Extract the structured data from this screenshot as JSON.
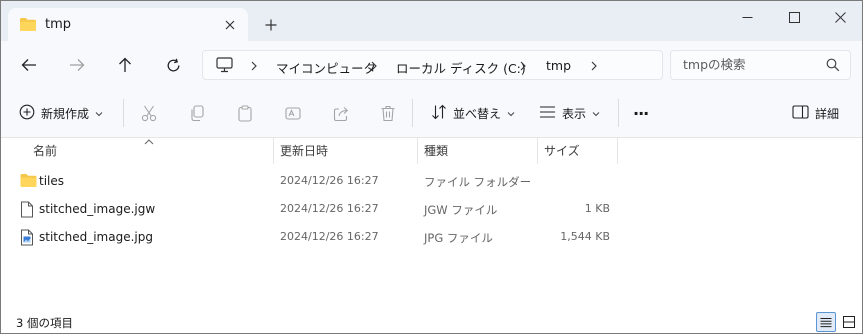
{
  "tab": {
    "title": "tmp",
    "folder_icon": "folder-icon",
    "close_icon": "close-icon"
  },
  "window": {
    "new_tab_icon": "plus-icon",
    "minimize_icon": "minimize-icon",
    "maximize_icon": "maximize-icon",
    "close_icon": "close-icon"
  },
  "nav": {
    "back_icon": "arrow-left-icon",
    "forward_icon": "arrow-right-icon",
    "up_icon": "arrow-up-icon",
    "refresh_icon": "refresh-icon",
    "breadcrumbs": [
      "マイコンピュータ",
      "ローカル ディスク (C:)",
      "tmp"
    ],
    "search_placeholder": "tmpの検索"
  },
  "toolbar": {
    "new_label": "新規作成",
    "sort_label": "並べ替え",
    "view_label": "表示",
    "more_label": "···",
    "details_label": "詳細"
  },
  "columns": {
    "name": "名前",
    "modified": "更新日時",
    "type": "種類",
    "size": "サイズ"
  },
  "files": [
    {
      "name": "tiles",
      "modified": "2024/12/26 16:27",
      "type": "ファイル フォルダー",
      "size": "",
      "icon": "folder-icon"
    },
    {
      "name": "stitched_image.jgw",
      "modified": "2024/12/26 16:27",
      "type": "JGW ファイル",
      "size": "1 KB",
      "icon": "file-icon"
    },
    {
      "name": "stitched_image.jpg",
      "modified": "2024/12/26 16:27",
      "type": "JPG ファイル",
      "size": "1,544 KB",
      "icon": "image-file-icon"
    }
  ],
  "status": {
    "item_count": "3 個の項目"
  },
  "colors": {
    "titlebar": "#e9eef5",
    "toolbar": "#f7f9fc",
    "folder": "#f4c84a",
    "accent": "#1a5fb4"
  }
}
